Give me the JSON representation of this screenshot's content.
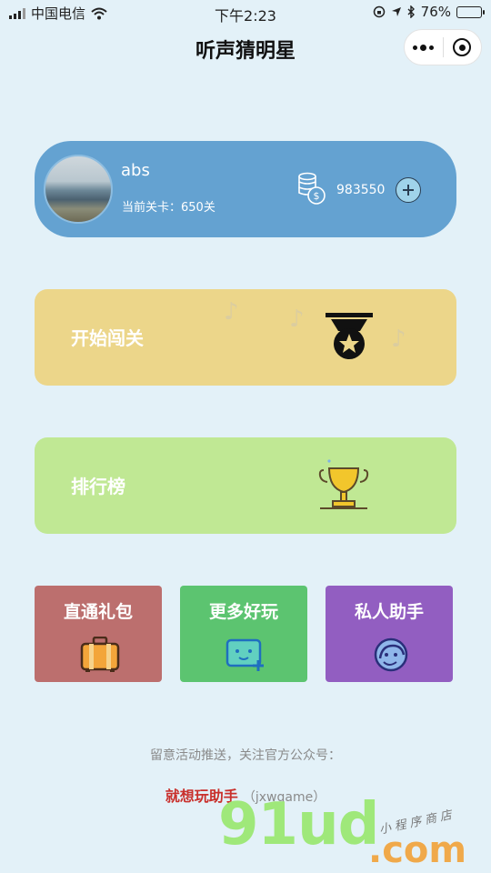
{
  "status_bar": {
    "carrier": "中国电信",
    "time": "下午2:23",
    "battery": "76%",
    "battery_level": 0.76
  },
  "nav": {
    "title": "听声猜明星"
  },
  "profile": {
    "username": "abs",
    "level_text": "当前关卡：650关",
    "coins": "983550"
  },
  "cards": {
    "start": {
      "label": "开始闯关"
    },
    "rank": {
      "label": "排行榜"
    },
    "gift": {
      "label": "直通礼包"
    },
    "more": {
      "label": "更多好玩"
    },
    "helper": {
      "label": "私人助手"
    }
  },
  "footer": {
    "notice": "留意活动推送，关注官方公众号：",
    "account_name": "就想玩助手",
    "account_id": "（jxwgame）"
  },
  "watermark": {
    "main": "91ud",
    "dotcom": ".com",
    "tag": "小程序商店"
  },
  "colors": {
    "background": "#e3f1f8",
    "profile_card": "#64a2d1",
    "start_card": "#ecd68a",
    "rank_card": "#c0e894",
    "gift_card": "#bc6f6e",
    "more_card": "#5cc470",
    "helper_card": "#925ec1",
    "account_name": "#c9302c"
  },
  "icons": {
    "signal": "signal-bars-icon",
    "wifi": "wifi-icon",
    "lock_rotation": "rotation-lock-icon",
    "location": "location-arrow-icon",
    "bluetooth": "bluetooth-icon",
    "menu": "more-dots-icon",
    "close": "target-circle-icon",
    "coins": "coin-stack-icon",
    "add": "plus-circle-icon",
    "medal": "medal-icon",
    "trophy": "trophy-icon",
    "gift": "suitcase-icon",
    "more": "game-controller-icon",
    "helper": "helper-face-icon",
    "note": "music-note-icon"
  }
}
